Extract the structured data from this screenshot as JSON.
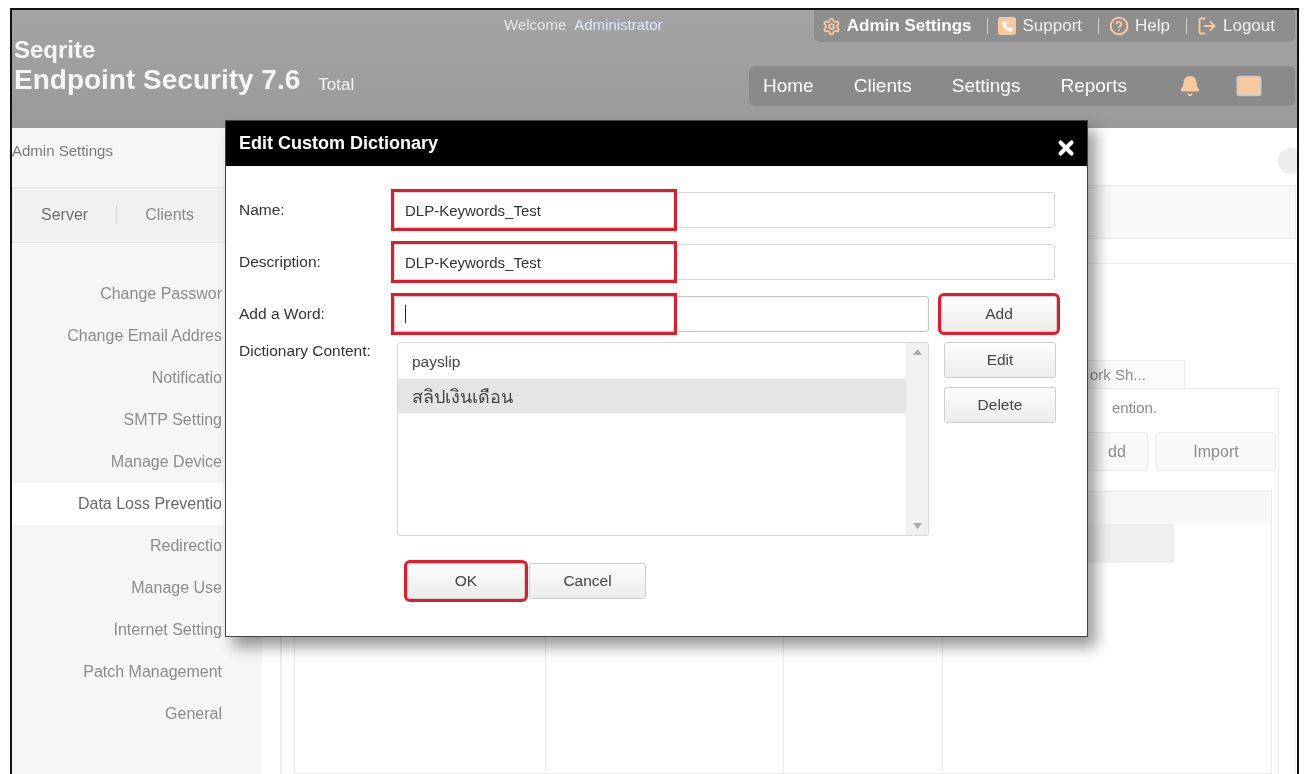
{
  "header": {
    "brand": "Seqrite",
    "product": "Endpoint Security 7.6",
    "edition": "Total",
    "welcome": "Welcome",
    "user": "Administrator",
    "top_links": [
      {
        "label": "Admin Settings",
        "kind": "gear",
        "selected": true
      },
      {
        "label": "Support",
        "kind": "phone",
        "selected": false
      },
      {
        "label": "Help",
        "kind": "question",
        "selected": false
      },
      {
        "label": "Logout",
        "kind": "logout",
        "selected": false
      }
    ],
    "nav": [
      "Home",
      "Clients",
      "Settings",
      "Reports"
    ]
  },
  "sidebar": {
    "title": "Admin Settings",
    "tabs": [
      {
        "label": "Server",
        "selected": true
      },
      {
        "label": "Clients",
        "selected": false
      }
    ],
    "items": [
      {
        "label": "Change Passwor",
        "selected": false
      },
      {
        "label": "Change Email Addres",
        "selected": false
      },
      {
        "label": "Notificatio",
        "selected": false
      },
      {
        "label": "SMTP Setting",
        "selected": false
      },
      {
        "label": "Manage Device",
        "selected": false
      },
      {
        "label": "Data Loss Preventio",
        "selected": true
      },
      {
        "label": "Redirectio",
        "selected": false
      },
      {
        "label": "Manage Use",
        "selected": false
      },
      {
        "label": "Internet Setting",
        "selected": false
      },
      {
        "label": "Patch Management",
        "selected": false
      },
      {
        "label": "General",
        "selected": false
      }
    ]
  },
  "main": {
    "tab": "ork Sh...",
    "note": "ention.",
    "buttons": [
      "dd",
      "Import"
    ]
  },
  "dialog": {
    "title": "Edit Custom Dictionary",
    "fields": [
      {
        "label": "Name:",
        "value": "DLP-Keywords_Test",
        "highlighted": true
      },
      {
        "label": "Description:",
        "value": "DLP-Keywords_Test",
        "highlighted": true
      },
      {
        "label": "Add a Word:",
        "highlighted": true,
        "focused": true
      }
    ],
    "add_button": {
      "label": "Add",
      "highlighted": true
    },
    "content_label": "Dictionary Content:",
    "words": [
      {
        "text": "payslip",
        "selected": false
      },
      {
        "text": "สลิปเงินเดือน",
        "selected": true
      }
    ],
    "side_buttons": [
      {
        "label": "Edit",
        "highlighted": false
      },
      {
        "label": "Delete",
        "highlighted": false
      }
    ],
    "footer_buttons": [
      {
        "label": "OK",
        "highlighted": true
      },
      {
        "label": "Cancel",
        "highlighted": false
      }
    ]
  }
}
